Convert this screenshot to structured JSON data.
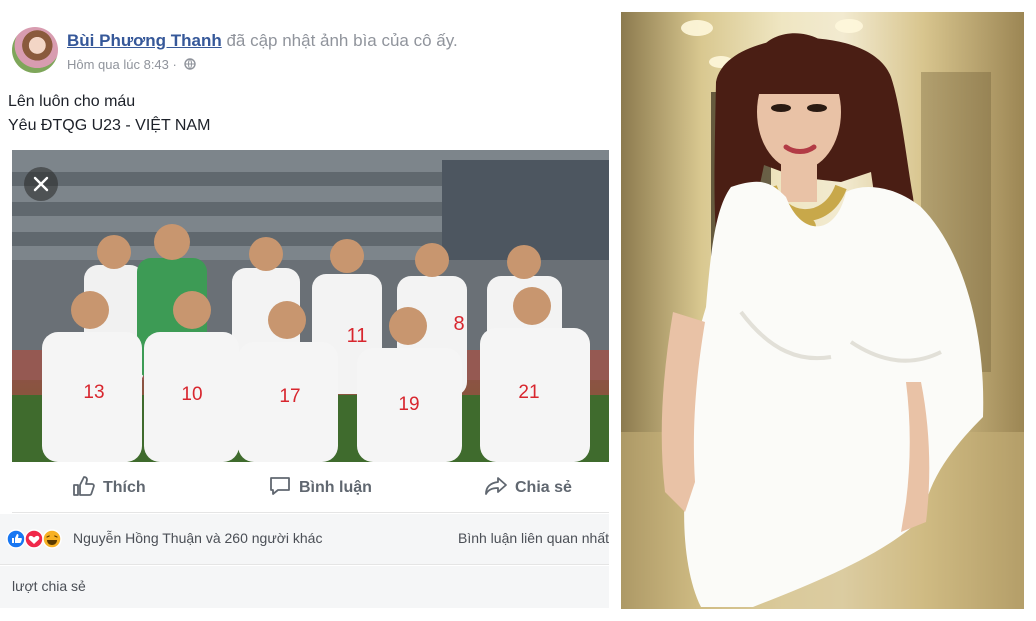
{
  "post": {
    "author": "Bùi Phương Thanh",
    "action": "đã cập nhật ảnh bìa của cô ấy.",
    "timestamp": "Hôm qua lúc 8:43",
    "audience_icon": "globe-icon",
    "text_lines": [
      "Lên luôn cho máu",
      "Yêu ĐTQG U23 - VIỆT NAM"
    ],
    "photo": {
      "close_icon": "close-icon",
      "jersey_numbers_back": [
        "11",
        "8"
      ],
      "jersey_numbers_front": [
        "13",
        "10",
        "17",
        "19",
        "21"
      ]
    },
    "actions": {
      "like": "Thích",
      "comment": "Bình luận",
      "share": "Chia sẻ"
    },
    "reactions": {
      "icons": [
        "like-reaction-icon",
        "love-reaction-icon",
        "haha-reaction-icon"
      ],
      "summary": "Nguyễn Hồng Thuận và 260 người khác",
      "related": "Bình luận liên quan nhất"
    },
    "shares": "lượt chia sẻ"
  },
  "colors": {
    "link": "#365899",
    "meta": "#90949c",
    "action": "#606770",
    "panel_bg": "#f5f6f7",
    "like_blue": "#1877f2",
    "love_red": "#f0284a",
    "haha_yellow": "#f7b125"
  }
}
